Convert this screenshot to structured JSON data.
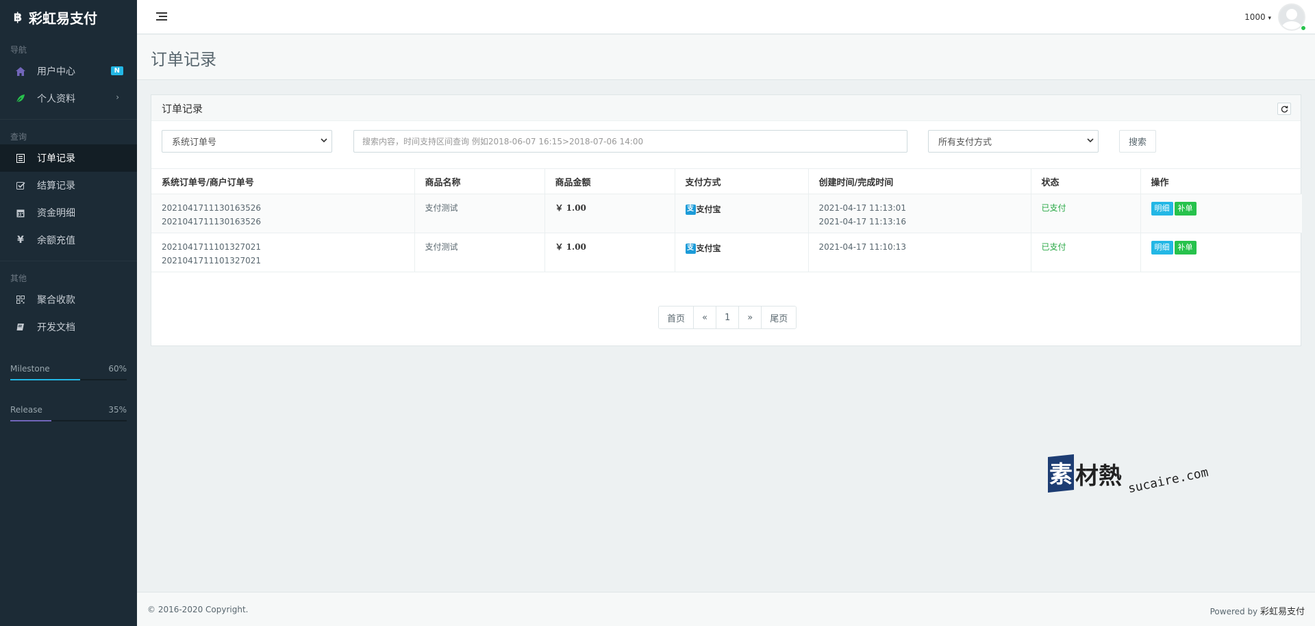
{
  "brand": {
    "name": "彩虹易支付",
    "icon": "bitcoin-icon"
  },
  "sidebar": {
    "sections": [
      {
        "header": "导航"
      },
      {
        "header": "查询"
      },
      {
        "header": "其他"
      }
    ],
    "nav": {
      "user_center": {
        "label": "用户中心",
        "badge": "N",
        "icon": "home-icon"
      },
      "profile": {
        "label": "个人资料",
        "icon": "leaf-icon",
        "caret": "›"
      },
      "orders": {
        "label": "订单记录",
        "icon": "list-icon"
      },
      "settlement": {
        "label": "结算记录",
        "icon": "check-square-icon"
      },
      "funds": {
        "label": "资金明细",
        "icon": "calendar-icon"
      },
      "recharge": {
        "label": "余额充值",
        "icon": "yen-icon"
      },
      "aggregate": {
        "label": "聚合收款",
        "icon": "qrcode-icon"
      },
      "docs": {
        "label": "开发文档",
        "icon": "book-icon"
      }
    },
    "progress": [
      {
        "label": "Milestone",
        "value_text": "60%",
        "value": 0.6,
        "color": "#23b7e5"
      },
      {
        "label": "Release",
        "value_text": "35%",
        "value": 0.35,
        "color": "#7266ba"
      }
    ]
  },
  "header": {
    "user_name": "1000",
    "caret": "▾"
  },
  "page": {
    "title": "订单记录"
  },
  "panel": {
    "title": "订单记录",
    "filters": {
      "order_type_selected": "系统订单号",
      "search_placeholder": "搜索内容，时间支持区间查询 例如2018-06-07 16:15>2018-07-06 14:00",
      "pay_type_selected": "所有支付方式",
      "search_button": "搜索"
    },
    "table": {
      "columns": [
        "系统订单号/商户订单号",
        "商品名称",
        "商品金额",
        "支付方式",
        "创建时间/完成时间",
        "状态",
        "操作"
      ],
      "rows": [
        {
          "trade_no": "2021041711130163526",
          "out_trade_no": "2021041711130163526",
          "name": "支付测试",
          "amount": "￥ 1.00",
          "pay_type": "支付宝",
          "created": "2021-04-17 11:13:01",
          "finished": "2021-04-17 11:13:16",
          "status": "已支付",
          "detail_button": "明细",
          "reissue_button": "补单"
        },
        {
          "trade_no": "2021041711101327021",
          "out_trade_no": "2021041711101327021",
          "name": "支付测试",
          "amount": "￥ 1.00",
          "pay_type": "支付宝",
          "created": "2021-04-17 11:10:13",
          "finished": "",
          "status": "已支付",
          "detail_button": "明细",
          "reissue_button": "补单"
        }
      ]
    },
    "pagination": {
      "first": "首页",
      "prev": "«",
      "current": "1",
      "next": "»",
      "last": "尾页"
    }
  },
  "watermark": {
    "first_char": "素",
    "rest": "材熱",
    "url": "sucaire.com"
  },
  "footer": {
    "copyright": "© 2016-2020 Copyright.",
    "powered_prefix": "Powered by ",
    "powered_name": "彩虹易支付"
  }
}
